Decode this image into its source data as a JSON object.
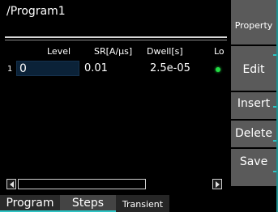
{
  "title": "/Program1",
  "table": {
    "columns": [
      "Level",
      "SR[A/µs]",
      "Dwell[s]",
      "Lo"
    ],
    "rows": [
      {
        "index": "1",
        "level": "0",
        "sr": "0.01",
        "dwell": "2.5e-05",
        "lo": "on"
      }
    ]
  },
  "tabs": [
    {
      "label": "Program"
    },
    {
      "label": "Steps"
    },
    {
      "label": "Transient"
    }
  ],
  "softkeys": [
    {
      "label": "Property"
    },
    {
      "label": "Edit"
    },
    {
      "label": "Insert"
    },
    {
      "label": "Delete"
    },
    {
      "label": "Save"
    }
  ],
  "colors": {
    "background": "#000000",
    "softkey": "#5a5a5a",
    "selected_cell": "#0b2238",
    "led_on": "#22dd44",
    "accent": "#2fc4c4"
  },
  "icons": [
    "scroll-left-icon",
    "scroll-right-icon",
    "status-led-icon"
  ]
}
